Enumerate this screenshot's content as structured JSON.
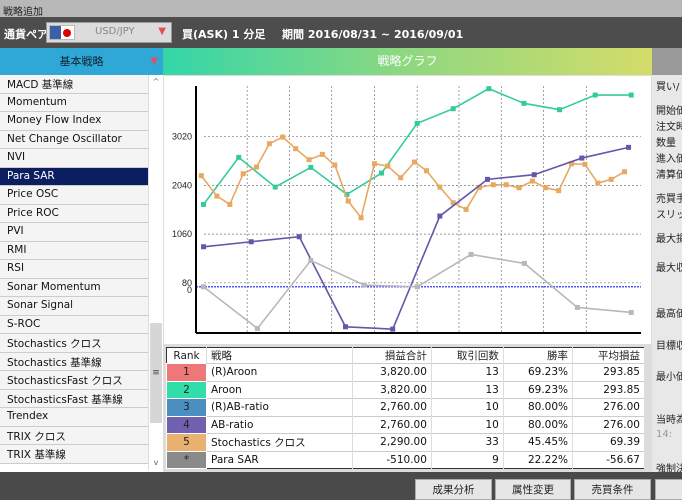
{
  "window": {
    "title": "戦略追加"
  },
  "toolbar": {
    "pair_label": "通貨ペア",
    "pair_value": "USD/JPY",
    "mode": "買(ASK) 1 分足",
    "period": "期間 2016/08/31 ~ 2016/09/01"
  },
  "headers": {
    "left": "基本戦略",
    "chart": "戦略グラフ"
  },
  "strategies": [
    "MACD 基準線",
    "Momentum",
    "Money Flow Index",
    "Net Change Oscillator",
    "NVI",
    "Para SAR",
    "Price OSC",
    "Price ROC",
    "PVI",
    "RMI",
    "RSI",
    "Sonar Momentum",
    "Sonar Signal",
    "S-ROC",
    "Stochastics クロス",
    "Stochastics 基準線",
    "StochasticsFast クロス",
    "StochasticsFast 基準線",
    "Trendex",
    "TRIX クロス",
    "TRIX 基準線"
  ],
  "selected_strategy": "Para SAR",
  "chart_data": {
    "type": "line",
    "xlim": [
      0,
      100
    ],
    "ylim": [
      -930,
      4040
    ],
    "yticks": [
      3020,
      2040,
      1060,
      80,
      0
    ],
    "xgrid": [
      11.5,
      21,
      30.5,
      40.1,
      49.7,
      59.1,
      68.6,
      78.1,
      87.7
    ],
    "zero_line": 0,
    "series": [
      {
        "name": "Aroon",
        "color": "#33cc99",
        "x": [
          1.7,
          9.6,
          17.8,
          25.8,
          33.9,
          41.7,
          49.7,
          57.8,
          65.8,
          73.7,
          81.7,
          89.7,
          97.8
        ],
        "y": [
          1657,
          2604,
          2006,
          2402,
          1859,
          2288,
          3288,
          3583,
          3986,
          3691,
          3563,
          3858,
          3858
        ]
      },
      {
        "name": "Stochastics クロス",
        "color": "#e8a860",
        "x": [
          1.2,
          4.7,
          7.6,
          10.6,
          13.6,
          16.5,
          19.5,
          22.4,
          25.4,
          28.4,
          31.2,
          34.2,
          37.1,
          40.1,
          43.1,
          46.0,
          49.1,
          51.8,
          54.8,
          57.8,
          60.7,
          63.7,
          66.8,
          69.7,
          72.6,
          75.6,
          78.6,
          81.5,
          84.4,
          87.4,
          90.3,
          93.3,
          96.3
        ],
        "y": [
          2235,
          1825,
          1657,
          2275,
          2409,
          2879,
          3013,
          2778,
          2557,
          2664,
          2449,
          1725,
          1389,
          2476,
          2429,
          2194,
          2510,
          2335,
          2006,
          1691,
          1557,
          2000,
          2053,
          2053,
          1993,
          2127,
          1993,
          1933,
          2476,
          2463,
          2087,
          2161,
          2315
        ]
      },
      {
        "name": "AB-ratio",
        "color": "#6655aa",
        "x": [
          1.7,
          12.4,
          23.2,
          33.6,
          44.2,
          54.8,
          65.5,
          76.0,
          86.7,
          97.2
        ],
        "y": [
          805,
          906,
          1007,
          -805,
          -852,
          1423,
          2161,
          2255,
          2590,
          2805
        ]
      },
      {
        "name": "Para SAR",
        "color": "#b8b8b8",
        "x": [
          1.7,
          13.8,
          25.8,
          37.8,
          49.7,
          61.8,
          73.8,
          85.7,
          97.8
        ],
        "y": [
          0,
          -839,
          530,
          34,
          0,
          651,
          470,
          -416,
          -517
        ]
      }
    ]
  },
  "table": {
    "headers": [
      "Rank",
      "戦略",
      "損益合計",
      "取引回数",
      "勝率",
      "平均損益"
    ],
    "rows": [
      {
        "rank": "1",
        "color": "#ee7777",
        "name": "(R)Aroon",
        "pl": "3,820.00",
        "trades": "13",
        "win": "69.23%",
        "avg": "293.85"
      },
      {
        "rank": "2",
        "color": "#33dd aa",
        "name": "Aroon",
        "pl": "3,820.00",
        "trades": "13",
        "win": "69.23%",
        "avg": "293.85"
      },
      {
        "rank": "3",
        "color": "#4a8fbf",
        "name": "(R)AB-ratio",
        "pl": "2,760.00",
        "trades": "10",
        "win": "80.00%",
        "avg": "276.00"
      },
      {
        "rank": "4",
        "color": "#7060b0",
        "name": "AB-ratio",
        "pl": "2,760.00",
        "trades": "10",
        "win": "80.00%",
        "avg": "276.00"
      },
      {
        "rank": "5",
        "color": "#eab070",
        "name": "Stochastics クロス",
        "pl": "2,290.00",
        "trades": "33",
        "win": "45.45%",
        "avg": "69.39"
      },
      {
        "rank": "*",
        "color": "#8a8a8a",
        "name": "Para SAR",
        "pl": "-510.00",
        "trades": "9",
        "win": "22.22%",
        "avg": "-56.67"
      }
    ]
  },
  "right_labels": [
    "買い/",
    "開始価",
    "注文時",
    "数量",
    "進入価",
    "清算価",
    "売買手",
    "スリッペ",
    "最大損",
    "最大収",
    "最高価",
    "目標収",
    "最小価",
    "当時為",
    "14:",
    "強制決"
  ],
  "buttons": [
    "成果分析",
    "属性変更",
    "売買条件",
    ""
  ]
}
